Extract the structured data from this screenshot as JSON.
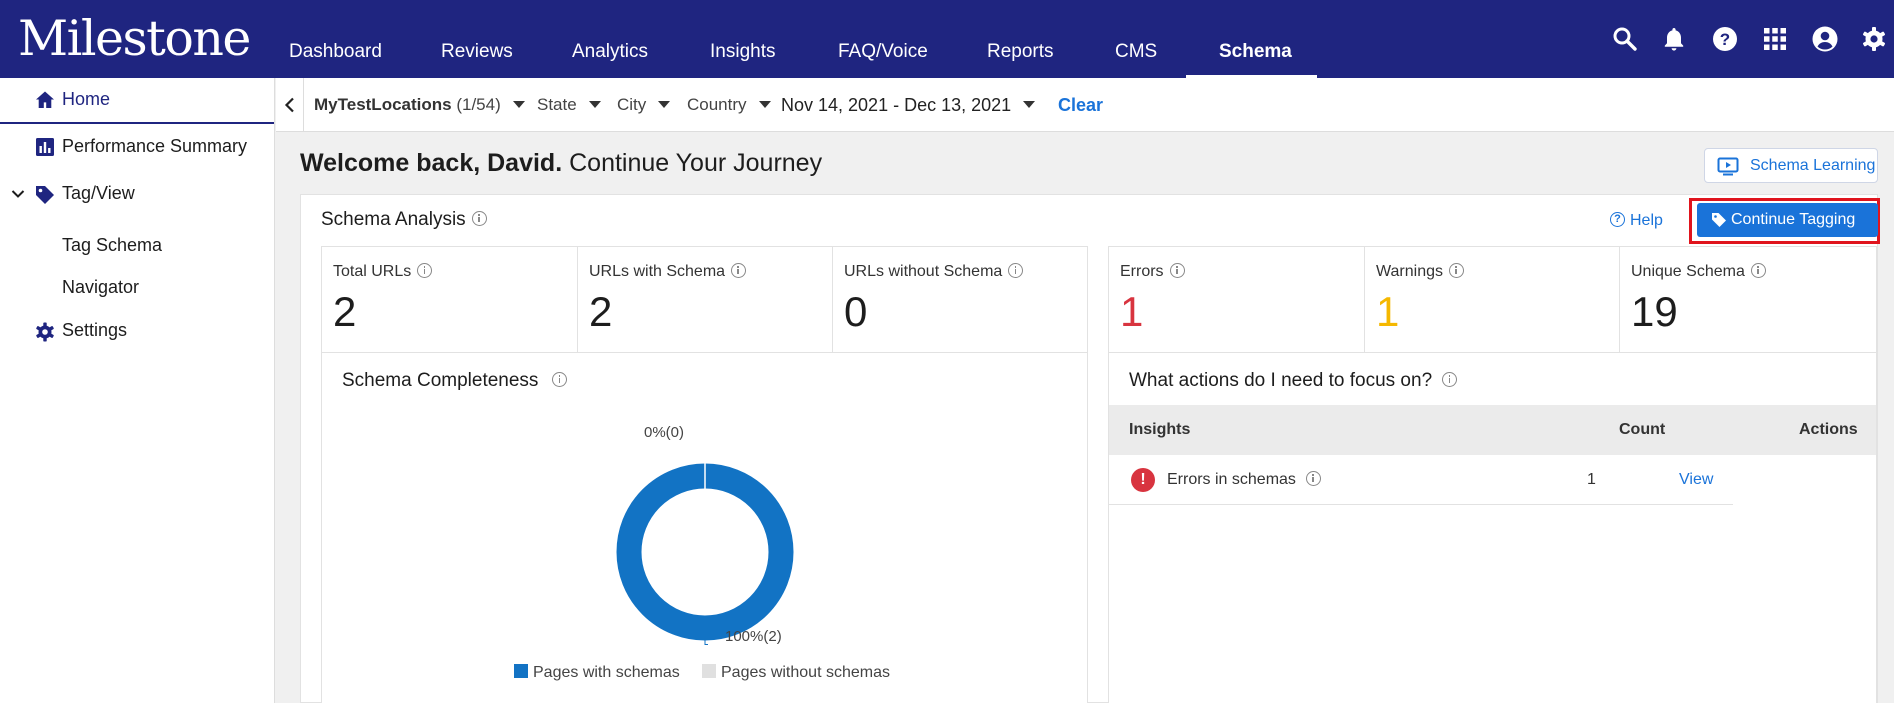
{
  "header": {
    "logo": "Milestone",
    "nav": [
      {
        "label": "Dashboard"
      },
      {
        "label": "Reviews"
      },
      {
        "label": "Analytics"
      },
      {
        "label": "Insights"
      },
      {
        "label": "FAQ/Voice"
      },
      {
        "label": "Reports"
      },
      {
        "label": "CMS"
      },
      {
        "label": "Schema"
      }
    ],
    "active_nav": "Schema",
    "icons": [
      "search-icon",
      "bell-icon",
      "help-icon",
      "apps-grid-icon",
      "account-icon",
      "settings-icon"
    ]
  },
  "sidebar": {
    "items": [
      {
        "label": "Home",
        "icon": "home-icon"
      },
      {
        "label": "Performance Summary",
        "icon": "bar-chart-icon"
      },
      {
        "label": "Tag/View",
        "icon": "tag-icon"
      },
      {
        "label": "Tag Schema"
      },
      {
        "label": "Navigator"
      },
      {
        "label": "Settings",
        "icon": "gear-icon"
      }
    ]
  },
  "filters": {
    "location_name": "MyTestLocations",
    "location_count": "(1/54)",
    "state": "State",
    "city": "City",
    "country": "Country",
    "date_range": "Nov 14, 2021 - Dec 13, 2021",
    "clear": "Clear"
  },
  "welcome": {
    "greeting": "Welcome back, David.",
    "subtitle": "Continue Your Journey"
  },
  "schema_learning": "Schema Learning",
  "card": {
    "title": "Schema Analysis",
    "help": "Help",
    "continue_tagging": "Continue Tagging",
    "stats_left": [
      {
        "label": "Total URLs",
        "value": "2"
      },
      {
        "label": "URLs with Schema",
        "value": "2"
      },
      {
        "label": "URLs without Schema",
        "value": "0"
      }
    ],
    "stats_right": [
      {
        "label": "Errors",
        "value": "1"
      },
      {
        "label": "Warnings",
        "value": "1"
      },
      {
        "label": "Unique Schema",
        "value": "19"
      }
    ],
    "colors": {
      "error": "#d8343f",
      "warning": "#f5b800",
      "accent": "#1a73d9",
      "with": "#1273c4",
      "without": "#e0e0e0"
    }
  },
  "completeness": {
    "title": "Schema Completeness",
    "label_without": "0%(0)",
    "label_with": "100%(2)",
    "legend": [
      "Pages with schemas",
      "Pages without schemas"
    ]
  },
  "chart_data": {
    "type": "pie",
    "donut": true,
    "title": "Schema Completeness",
    "categories": [
      "Pages with schemas",
      "Pages without schemas"
    ],
    "values": [
      2,
      0
    ],
    "percentages": [
      100,
      0
    ],
    "colors": [
      "#1273c4",
      "#e0e0e0"
    ]
  },
  "actions": {
    "title": "What actions do I need to focus on?",
    "columns": [
      "Insights",
      "Count",
      "Actions"
    ],
    "rows": [
      {
        "insight": "Errors in schemas",
        "count": "1",
        "action": "View"
      }
    ]
  }
}
